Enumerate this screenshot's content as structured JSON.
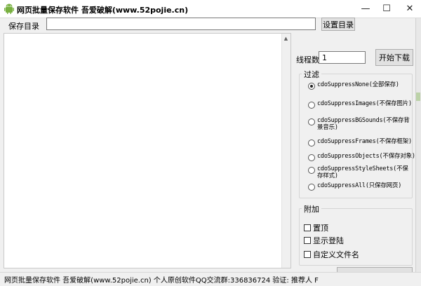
{
  "window": {
    "title": "网页批量保存软件  吾爱破解(www.52pojie.cn)",
    "controls": {
      "minimize": "—",
      "maximize": "☐",
      "close": "✕"
    }
  },
  "save_dir": {
    "label": "保存目录",
    "value": "",
    "button": "设置目录"
  },
  "threads": {
    "label": "线程数",
    "value": "1",
    "start_button": "开始下载"
  },
  "filter": {
    "title": "过滤",
    "options": [
      {
        "label": "cdoSuppressNone(全部保存)",
        "checked": true
      },
      {
        "label": "cdoSuppressImages(不保存图片)",
        "checked": false
      },
      {
        "label": "cdoSuppressBGSounds(不保存背景音乐)",
        "checked": false
      },
      {
        "label": "cdoSuppressFrames(不保存框架)",
        "checked": false
      },
      {
        "label": "cdoSuppressObjects(不保存对象)",
        "checked": false
      },
      {
        "label": "cdoSuppressStyleSheets(不保存样式)",
        "checked": false
      },
      {
        "label": "cdoSuppressAll(只保存网页)",
        "checked": false
      }
    ]
  },
  "extra": {
    "title": "附加",
    "options": [
      {
        "label": "置顶",
        "checked": false
      },
      {
        "label": "显示登陆",
        "checked": false
      },
      {
        "label": "自定义文件名",
        "checked": false
      }
    ]
  },
  "status": {
    "text": "网页批量保存软件  吾爱破解(www.52pojie.cn)  个人原创软件QQ交流群:336836724  验证: 推荐人 F"
  },
  "colors": {
    "window_bg": "#f0f0f0",
    "titlebar_bg": "#ffffff",
    "button_bg": "#e1e1e1",
    "app_icon": "#78b040"
  },
  "icons": {
    "app": "android-icon",
    "scroll_up": "triangle-up-icon"
  }
}
